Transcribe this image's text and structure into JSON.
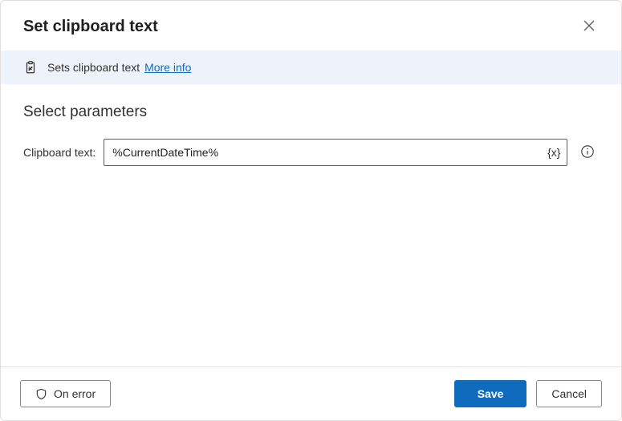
{
  "header": {
    "title": "Set clipboard text"
  },
  "info": {
    "description": "Sets clipboard text",
    "more_info_label": "More info"
  },
  "section": {
    "title": "Select parameters"
  },
  "field": {
    "label": "Clipboard text:",
    "value": "%CurrentDateTime%",
    "var_button": "{x}"
  },
  "footer": {
    "on_error": "On error",
    "save": "Save",
    "cancel": "Cancel"
  }
}
